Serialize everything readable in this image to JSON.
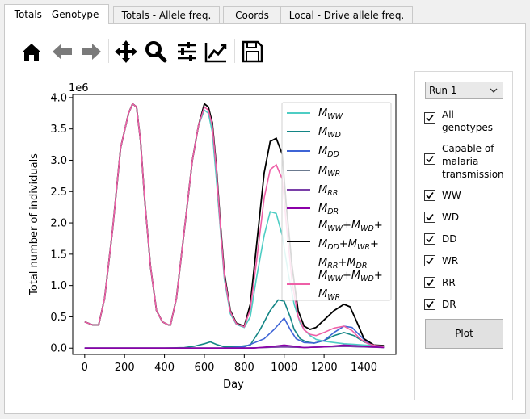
{
  "tabs": [
    {
      "label": "Totals - Genotype",
      "active": true
    },
    {
      "label": "Totals - Allele freq.",
      "active": false
    },
    {
      "label": "Coords",
      "active": false
    },
    {
      "label": "Local - Drive allele freq.",
      "active": false
    }
  ],
  "toolbar": {
    "icons": [
      "home-icon",
      "back-arrow-icon",
      "forward-arrow-icon",
      "pan-icon",
      "zoom-icon",
      "subplots-config-icon",
      "edit-axis-icon",
      "save-icon"
    ]
  },
  "sidebar": {
    "run_select": "Run 1",
    "checkboxes": [
      {
        "label": "All\ngenotypes",
        "checked": true
      },
      {
        "label": "Capable of\nmalaria\ntransmission",
        "checked": true
      },
      {
        "label": "WW",
        "checked": true
      },
      {
        "label": "WD",
        "checked": true
      },
      {
        "label": "DD",
        "checked": true
      },
      {
        "label": "WR",
        "checked": true
      },
      {
        "label": "RR",
        "checked": true
      },
      {
        "label": "DR",
        "checked": true
      }
    ],
    "plot_button": "Plot"
  },
  "chart_data": {
    "type": "line",
    "xlabel": "Day",
    "ylabel": "Total number of individuals",
    "scale_label": "1e6",
    "xlim": [
      -60,
      1560
    ],
    "ylim": [
      -0.1,
      4.05
    ],
    "xticks": [
      0,
      200,
      400,
      600,
      800,
      1000,
      1200,
      1400
    ],
    "yticks": [
      0.0,
      0.5,
      1.0,
      1.5,
      2.0,
      2.5,
      3.0,
      3.5,
      4.0
    ],
    "legend_position": "upper-right",
    "series": [
      {
        "legend": "M_WW",
        "color": "#4ecdc4",
        "x": [
          0,
          40,
          70,
          100,
          140,
          180,
          220,
          240,
          260,
          280,
          300,
          330,
          360,
          390,
          420,
          430,
          460,
          500,
          540,
          570,
          600,
          620,
          640,
          660,
          680,
          700,
          730,
          760,
          800,
          830,
          860,
          900,
          930,
          960,
          990,
          1020,
          1050,
          1080,
          1100,
          1130,
          1160,
          1200,
          1250,
          1300,
          1350,
          1400,
          1450,
          1500
        ],
        "y": [
          0.42,
          0.37,
          0.37,
          0.8,
          1.9,
          3.2,
          3.75,
          3.9,
          3.85,
          3.3,
          2.4,
          1.3,
          0.6,
          0.42,
          0.37,
          0.37,
          0.8,
          1.9,
          3.0,
          3.55,
          3.8,
          3.75,
          3.45,
          2.7,
          1.9,
          1.1,
          0.55,
          0.38,
          0.33,
          0.5,
          1.1,
          1.8,
          2.18,
          2.15,
          1.8,
          1.2,
          0.7,
          0.4,
          0.3,
          0.2,
          0.14,
          0.11,
          0.09,
          0.07,
          0.06,
          0.05,
          0.04,
          0.03
        ]
      },
      {
        "legend": "M_WD",
        "color": "#138585",
        "x": [
          0,
          400,
          500,
          550,
          600,
          630,
          660,
          700,
          760,
          830,
          880,
          930,
          970,
          1000,
          1030,
          1050,
          1080,
          1110,
          1150,
          1200,
          1250,
          1300,
          1350,
          1400,
          1450,
          1500
        ],
        "y": [
          0,
          0,
          0.01,
          0.03,
          0.07,
          0.1,
          0.06,
          0.02,
          0.02,
          0.05,
          0.3,
          0.6,
          0.77,
          0.75,
          0.5,
          0.3,
          0.15,
          0.1,
          0.08,
          0.12,
          0.2,
          0.25,
          0.2,
          0.1,
          0.04,
          0.02
        ]
      },
      {
        "legend": "M_DD",
        "color": "#3e64d6",
        "x": [
          0,
          700,
          800,
          900,
          950,
          1000,
          1030,
          1060,
          1100,
          1150,
          1200,
          1250,
          1300,
          1340,
          1380,
          1420,
          1460,
          1500
        ],
        "y": [
          0,
          0,
          0.02,
          0.15,
          0.3,
          0.48,
          0.3,
          0.15,
          0.09,
          0.08,
          0.12,
          0.25,
          0.35,
          0.33,
          0.2,
          0.08,
          0.03,
          0.02
        ]
      },
      {
        "legend": "M_WR",
        "color": "#6b7a8f",
        "x": [
          0,
          800,
          900,
          1000,
          1100,
          1200,
          1300,
          1400,
          1500
        ],
        "y": [
          0,
          0,
          0.01,
          0.02,
          0.01,
          0.02,
          0.03,
          0.02,
          0.01
        ]
      },
      {
        "legend": "M_RR",
        "color": "#7a3fa8",
        "x": [
          0,
          800,
          900,
          1000,
          1100,
          1200,
          1300,
          1400,
          1500
        ],
        "y": [
          0,
          0,
          0.01,
          0.02,
          0.01,
          0.02,
          0.03,
          0.02,
          0.01
        ]
      },
      {
        "legend": "M_DR",
        "color": "#8b00a8",
        "x": [
          0,
          850,
          950,
          1000,
          1050,
          1100,
          1200,
          1300,
          1400,
          1500
        ],
        "y": [
          0,
          0,
          0.03,
          0.05,
          0.03,
          0.01,
          0.02,
          0.05,
          0.03,
          0.01
        ]
      },
      {
        "legend": "M_WW+M_WD+M_DD+M_WR+M_RR+M_DR",
        "color": "#000000",
        "x": [
          0,
          40,
          70,
          100,
          140,
          180,
          220,
          240,
          260,
          280,
          300,
          330,
          360,
          390,
          420,
          430,
          460,
          500,
          540,
          570,
          600,
          620,
          640,
          660,
          680,
          700,
          730,
          760,
          800,
          830,
          860,
          900,
          930,
          960,
          990,
          1010,
          1040,
          1070,
          1100,
          1130,
          1160,
          1200,
          1250,
          1300,
          1330,
          1360,
          1400,
          1450,
          1500
        ],
        "y": [
          0.42,
          0.37,
          0.37,
          0.8,
          1.9,
          3.2,
          3.75,
          3.9,
          3.85,
          3.3,
          2.4,
          1.3,
          0.6,
          0.42,
          0.37,
          0.37,
          0.8,
          1.9,
          3.0,
          3.55,
          3.9,
          3.85,
          3.6,
          2.9,
          2.0,
          1.2,
          0.6,
          0.4,
          0.35,
          0.7,
          1.6,
          2.8,
          3.3,
          3.35,
          3.1,
          2.3,
          1.3,
          0.6,
          0.35,
          0.3,
          0.33,
          0.45,
          0.6,
          0.7,
          0.66,
          0.45,
          0.15,
          0.05,
          0.04
        ]
      },
      {
        "legend": "M_WW+M_WD+M_WR",
        "color": "#ee5fa7",
        "x": [
          0,
          40,
          70,
          100,
          140,
          180,
          220,
          240,
          260,
          280,
          300,
          330,
          360,
          390,
          420,
          430,
          460,
          500,
          540,
          570,
          600,
          620,
          640,
          660,
          680,
          700,
          730,
          760,
          800,
          830,
          860,
          900,
          930,
          960,
          990,
          1010,
          1040,
          1070,
          1100,
          1130,
          1160,
          1200,
          1250,
          1300,
          1340,
          1380,
          1420,
          1460,
          1500
        ],
        "y": [
          0.42,
          0.37,
          0.37,
          0.8,
          1.9,
          3.2,
          3.75,
          3.9,
          3.85,
          3.3,
          2.4,
          1.3,
          0.6,
          0.42,
          0.37,
          0.37,
          0.8,
          1.9,
          3.0,
          3.55,
          3.85,
          3.8,
          3.55,
          2.85,
          1.95,
          1.15,
          0.58,
          0.39,
          0.34,
          0.62,
          1.35,
          2.4,
          2.85,
          2.93,
          2.7,
          2.0,
          1.05,
          0.5,
          0.29,
          0.22,
          0.2,
          0.25,
          0.32,
          0.35,
          0.28,
          0.15,
          0.07,
          0.04,
          0.03
        ]
      }
    ]
  }
}
